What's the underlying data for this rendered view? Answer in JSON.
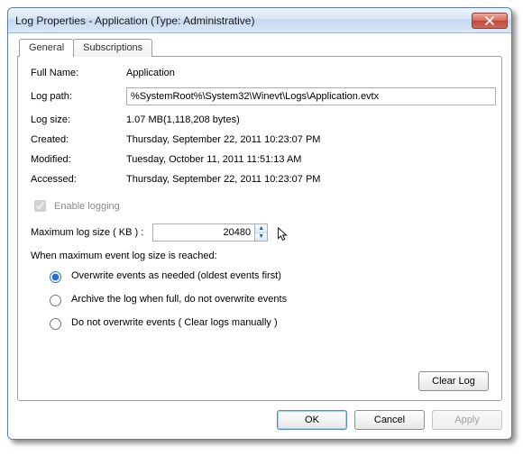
{
  "window": {
    "title": "Log Properties - Application (Type: Administrative)"
  },
  "tabs": {
    "general": "General",
    "subscriptions": "Subscriptions"
  },
  "fields": {
    "full_name_label": "Full Name:",
    "full_name_value": "Application",
    "log_path_label": "Log path:",
    "log_path_value": "%SystemRoot%\\System32\\Winevt\\Logs\\Application.evtx",
    "log_size_label": "Log size:",
    "log_size_value": "1.07 MB(1,118,208 bytes)",
    "created_label": "Created:",
    "created_value": "Thursday, September 22, 2011 10:23:07 PM",
    "modified_label": "Modified:",
    "modified_value": "Tuesday, October 11, 2011 11:51:13 AM",
    "accessed_label": "Accessed:",
    "accessed_value": "Thursday, September 22, 2011 10:23:07 PM"
  },
  "logging": {
    "enable_label": "Enable logging",
    "enable_checked": true,
    "max_label": "Maximum log size ( KB ) :",
    "max_value": "20480",
    "when_label": "When maximum event log size is reached:",
    "opt_overwrite": "Overwrite events as needed (oldest events first)",
    "opt_archive": "Archive the log when full, do not overwrite events",
    "opt_donot": "Do not overwrite events ( Clear logs manually )",
    "selected": "overwrite"
  },
  "buttons": {
    "clear_log": "Clear Log",
    "ok": "OK",
    "cancel": "Cancel",
    "apply": "Apply"
  }
}
